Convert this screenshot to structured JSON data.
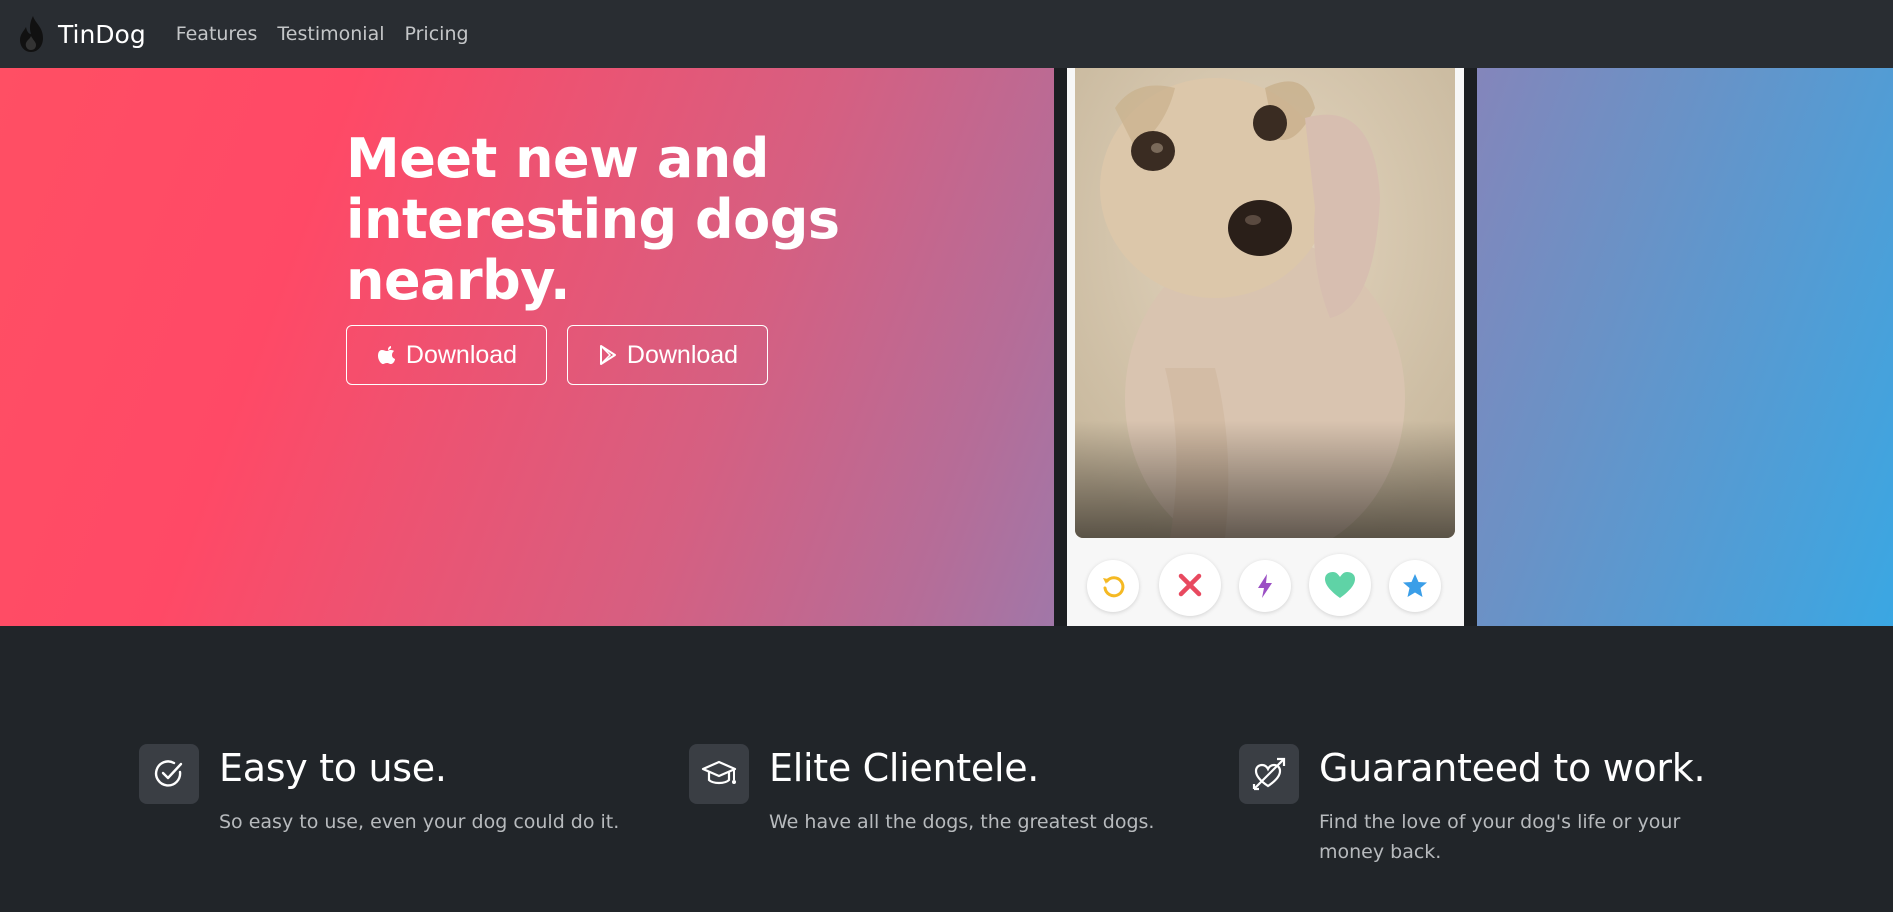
{
  "navbar": {
    "brand": "TinDog",
    "links": [
      "Features",
      "Testimonial",
      "Pricing"
    ]
  },
  "hero": {
    "title": "Meet new and interesting dogs nearby.",
    "buttons": [
      {
        "label": "Download",
        "icon": "apple-icon"
      },
      {
        "label": "Download",
        "icon": "google-play-icon"
      }
    ]
  },
  "phone": {
    "actions": [
      {
        "icon": "rewind-icon",
        "color": "#f5b923"
      },
      {
        "icon": "close-icon",
        "color": "#e8495f"
      },
      {
        "icon": "lightning-icon",
        "color": "#9b4fc4"
      },
      {
        "icon": "heart-icon",
        "color": "#5fd3a6"
      },
      {
        "icon": "star-icon",
        "color": "#3a9ee8"
      }
    ]
  },
  "features": [
    {
      "title": "Easy to use.",
      "text": "So easy to use, even your dog could do it.",
      "icon": "check-circle-icon"
    },
    {
      "title": "Elite Clientele.",
      "text": "We have all the dogs, the greatest dogs.",
      "icon": "graduation-cap-icon"
    },
    {
      "title": "Guaranteed to work.",
      "text": "Find the love of your dog's life or your money back.",
      "icon": "heart-arrow-icon"
    }
  ],
  "colors": {
    "navbar": "#292d32",
    "background": "#212529",
    "hero_start": "#ff4966",
    "hero_end": "#3aa7e3"
  }
}
